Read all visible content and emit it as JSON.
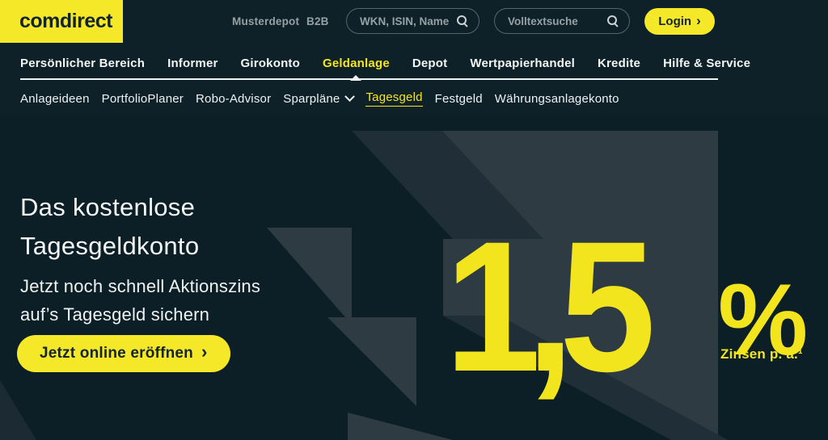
{
  "header": {
    "logo_text": "comdirect",
    "musterdepot_label": "Musterdepot",
    "b2b_label": "B2B",
    "wkn_search": {
      "placeholder": "WKN, ISIN, Name",
      "value": ""
    },
    "fulltext_search": {
      "placeholder": "Volltextsuche",
      "value": ""
    },
    "login": {
      "label": "Login",
      "chevron": "›"
    }
  },
  "nav": {
    "active_item": "Geldanlage",
    "items": [
      "Persönlicher Bereich",
      "Informer",
      "Girokonto",
      "Geldanlage",
      "Depot",
      "Wertpapierhandel",
      "Kredite",
      "Hilfe & Service"
    ]
  },
  "subnav": {
    "active_item": "Tagesgeld",
    "items": [
      "Anlageideen",
      "PortfolioPlaner",
      "Robo-Advisor",
      "Sparpläne",
      "Tagesgeld",
      "Festgeld",
      "Währungsanlagekonto"
    ]
  },
  "hero": {
    "heading_line1": "Das kostenlose",
    "heading_line2": "Tagesgeldkonto",
    "subline1": "Jetzt noch schnell Aktionszins",
    "subline2": "auf’s Tagesgeld sichern",
    "cta": {
      "label": "Jetzt online eröffnen",
      "chevron": "›"
    },
    "rate": {
      "value": "1,5",
      "unit": "%",
      "caption": "Zinsen p. a.¹"
    }
  },
  "colors": {
    "brand_yellow": "#f5e829",
    "rate_yellow": "#f2e51d",
    "background_dark": "#0e2028",
    "shape_light": "#2e3b42",
    "shape_medium": "#202f37",
    "text_white": "#f2f6f6",
    "text_gray": "#96a1a5"
  }
}
